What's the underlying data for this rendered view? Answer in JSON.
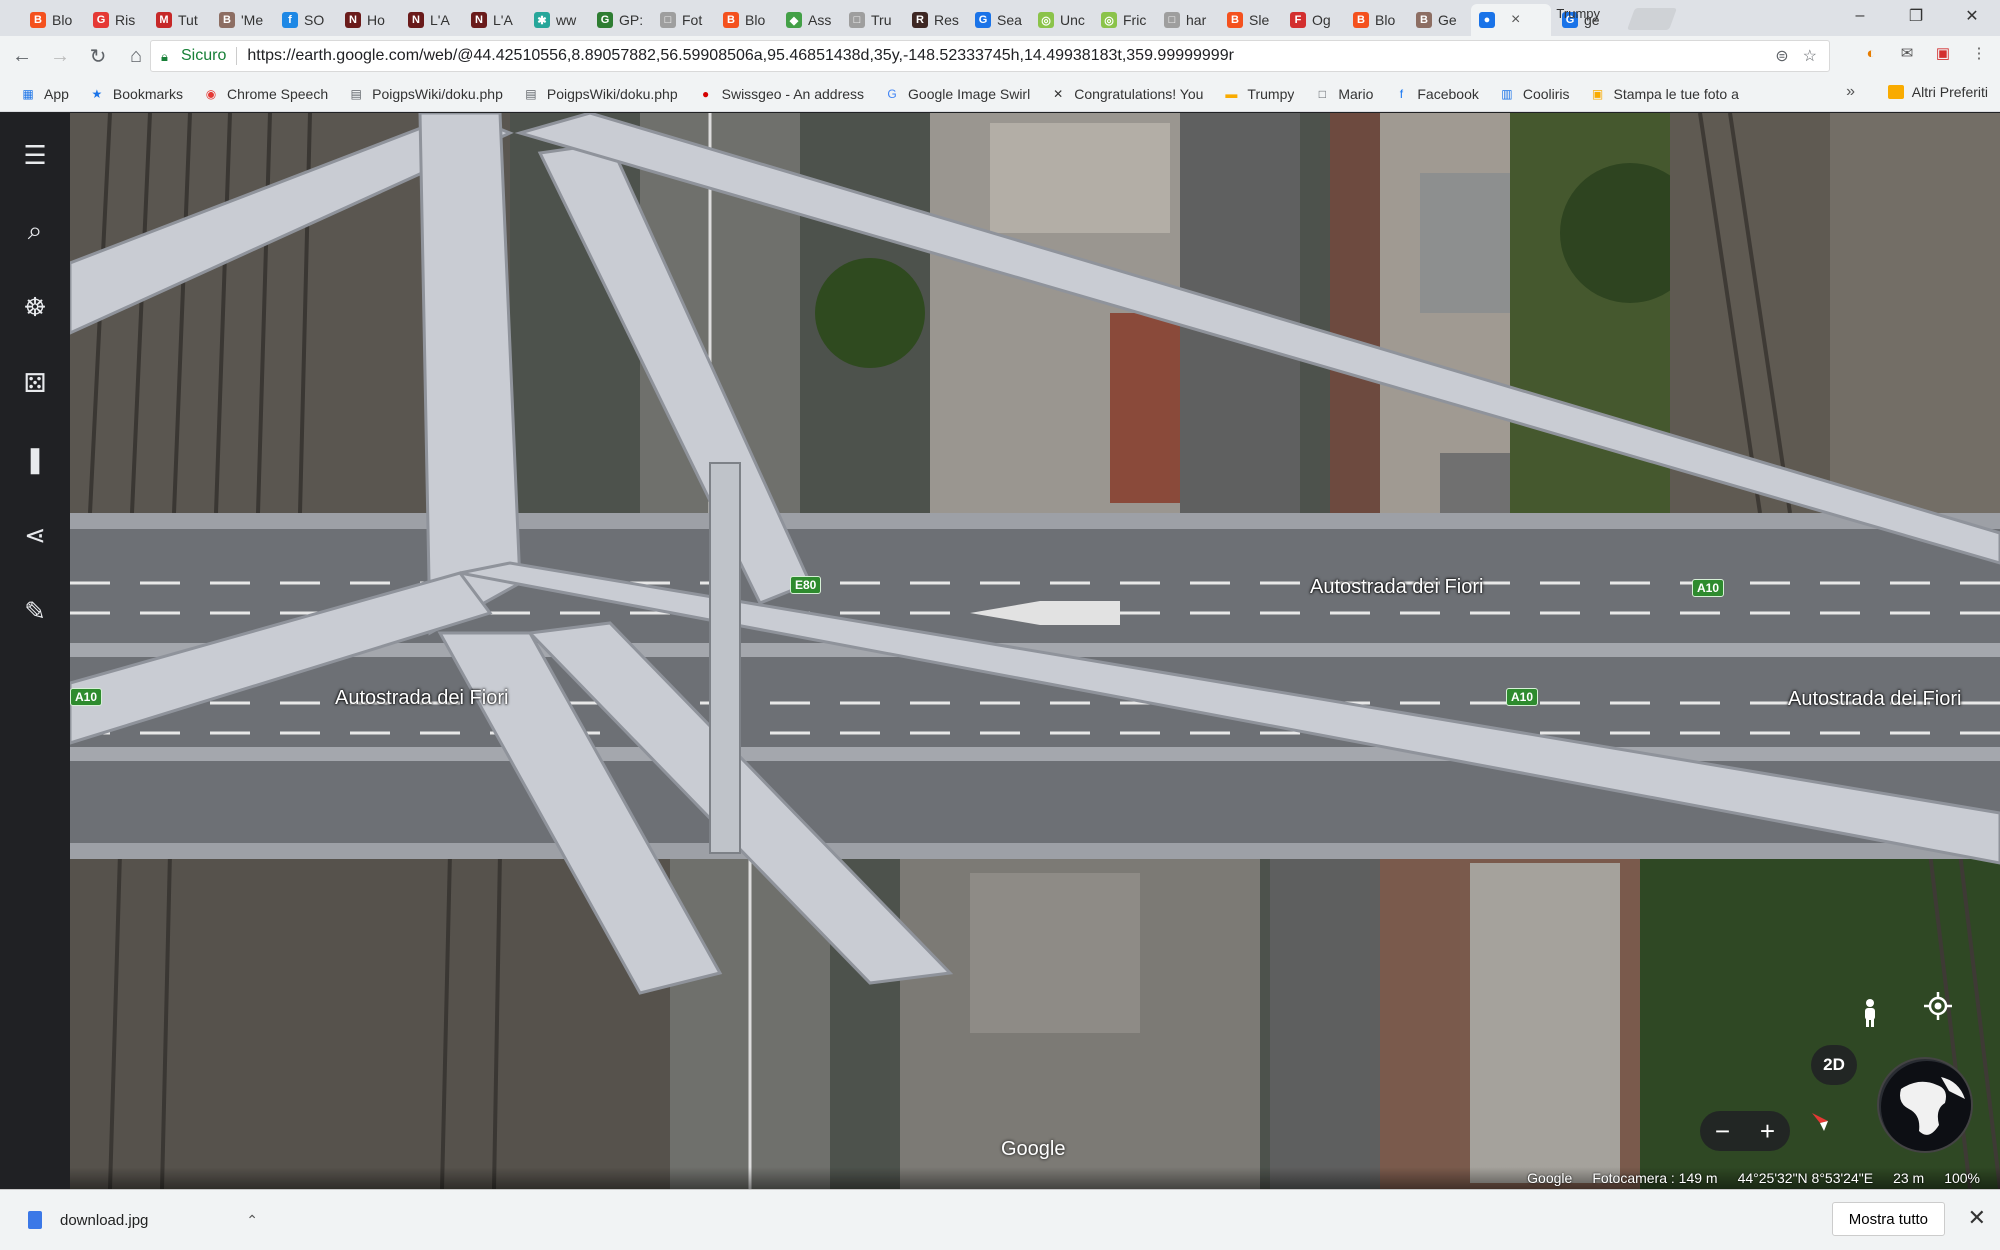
{
  "tabs": [
    {
      "label": "Blo",
      "fav_color": "#f4511e",
      "fav_char": "B"
    },
    {
      "label": "Ris",
      "fav_color": "#e53935",
      "fav_char": "G"
    },
    {
      "label": "Tut",
      "fav_color": "#c62828",
      "fav_char": "M"
    },
    {
      "label": "'Me",
      "fav_color": "#8d6e63",
      "fav_char": "B"
    },
    {
      "label": "SO",
      "fav_color": "#1e88e5",
      "fav_char": "f"
    },
    {
      "label": "Ho",
      "fav_color": "#6a1b1b",
      "fav_char": "N"
    },
    {
      "label": "L'A",
      "fav_color": "#6a1b1b",
      "fav_char": "N"
    },
    {
      "label": "L'A",
      "fav_color": "#6a1b1b",
      "fav_char": "N"
    },
    {
      "label": "ww",
      "fav_color": "#26a69a",
      "fav_char": "✱"
    },
    {
      "label": "GP:",
      "fav_color": "#2e7d32",
      "fav_char": "G"
    },
    {
      "label": "Fot",
      "fav_color": "#9e9e9e",
      "fav_char": "□"
    },
    {
      "label": "Blo",
      "fav_color": "#f4511e",
      "fav_char": "B"
    },
    {
      "label": "Ass",
      "fav_color": "#43a047",
      "fav_char": "◆"
    },
    {
      "label": "Tru",
      "fav_color": "#9e9e9e",
      "fav_char": "□"
    },
    {
      "label": "Res",
      "fav_color": "#3e2723",
      "fav_char": "R"
    },
    {
      "label": "Sea",
      "fav_color": "#1a73e8",
      "fav_char": "G"
    },
    {
      "label": "Unc",
      "fav_color": "#8bc34a",
      "fav_char": "◎"
    },
    {
      "label": "Fric",
      "fav_color": "#8bc34a",
      "fav_char": "◎"
    },
    {
      "label": "har",
      "fav_color": "#9e9e9e",
      "fav_char": "□"
    },
    {
      "label": "Sle",
      "fav_color": "#f4511e",
      "fav_char": "B"
    },
    {
      "label": "Og",
      "fav_color": "#d32f2f",
      "fav_char": "F"
    },
    {
      "label": "Blo",
      "fav_color": "#f4511e",
      "fav_char": "B"
    },
    {
      "label": "Ge",
      "fav_color": "#8d6e63",
      "fav_char": "B"
    },
    {
      "label": "",
      "fav_color": "#1a73e8",
      "fav_char": "●",
      "active": true
    },
    {
      "label": "ge",
      "fav_color": "#1a73e8",
      "fav_char": "G"
    }
  ],
  "window": {
    "profile": "Trumpy",
    "minimize": "–",
    "restore": "❐",
    "close": "✕"
  },
  "toolbar": {
    "back": "←",
    "forward": "→",
    "reload": "↻",
    "home": "⌂",
    "secure_label": "Sicuro",
    "url": "https://earth.google.com/web/@44.42510556,8.89057882,56.59908506a,95.46851438d,35y,-148.52333745h,14.49938183t,359.99999999r"
  },
  "bookmarks": [
    {
      "label": "App",
      "icon_color": "#1a73e8",
      "icon": "▦"
    },
    {
      "label": "Bookmarks",
      "icon_color": "#1a73e8",
      "icon": "★"
    },
    {
      "label": "Chrome Speech",
      "icon_color": "#e53935",
      "icon": "◉"
    },
    {
      "label": "PoigpsWiki/doku.php",
      "icon_color": "#5f6368",
      "icon": "▤"
    },
    {
      "label": "PoigpsWiki/doku.php",
      "icon_color": "#5f6368",
      "icon": "▤"
    },
    {
      "label": "Swissgeo - An address",
      "icon_color": "#d50000",
      "icon": "●"
    },
    {
      "label": "Google Image Swirl",
      "icon_color": "#4285f4",
      "icon": "G"
    },
    {
      "label": "Congratulations! You",
      "icon_color": "#333",
      "icon": "✕"
    },
    {
      "label": "Trumpy",
      "icon_color": "#f9ab00",
      "icon": "▬"
    },
    {
      "label": "Mario",
      "icon_color": "#5f6368",
      "icon": "□"
    },
    {
      "label": "Facebook",
      "icon_color": "#1877f2",
      "icon": "f"
    },
    {
      "label": "Cooliris",
      "icon_color": "#1a73e8",
      "icon": "▥"
    },
    {
      "label": "Stampa le tue foto a",
      "icon_color": "#f9ab00",
      "icon": "▣"
    }
  ],
  "bookmarks_more": "»",
  "bookmarks_other": "Altri Preferiti",
  "sidebar": [
    {
      "name": "menu-icon",
      "glyph": "☰"
    },
    {
      "name": "search-icon",
      "glyph": "⌕"
    },
    {
      "name": "voyager-icon",
      "glyph": "☸"
    },
    {
      "name": "feeling-lucky-icon",
      "glyph": "⚄"
    },
    {
      "name": "projects-icon",
      "glyph": "❚"
    },
    {
      "name": "share-icon",
      "glyph": "⋖"
    },
    {
      "name": "measure-icon",
      "glyph": "✎"
    }
  ],
  "map": {
    "road_labels": [
      "Autostrada dei Fiori",
      "Autostrada dei Fiori",
      "Autostrada dei Fiori"
    ],
    "shields": [
      "E80",
      "A10",
      "A10",
      "A10"
    ],
    "watermark": "Google",
    "view_mode": "2D",
    "zoom_out": "−",
    "zoom_in": "+"
  },
  "status": {
    "provider": "Google",
    "camera": "Fotocamera : 149 m",
    "coords": "44°25'32\"N 8°53'24\"E",
    "scale": "23 m",
    "loading": "100%"
  },
  "downloads": {
    "filename": "download.jpg",
    "show_all": "Mostra tutto",
    "close": "✕"
  }
}
